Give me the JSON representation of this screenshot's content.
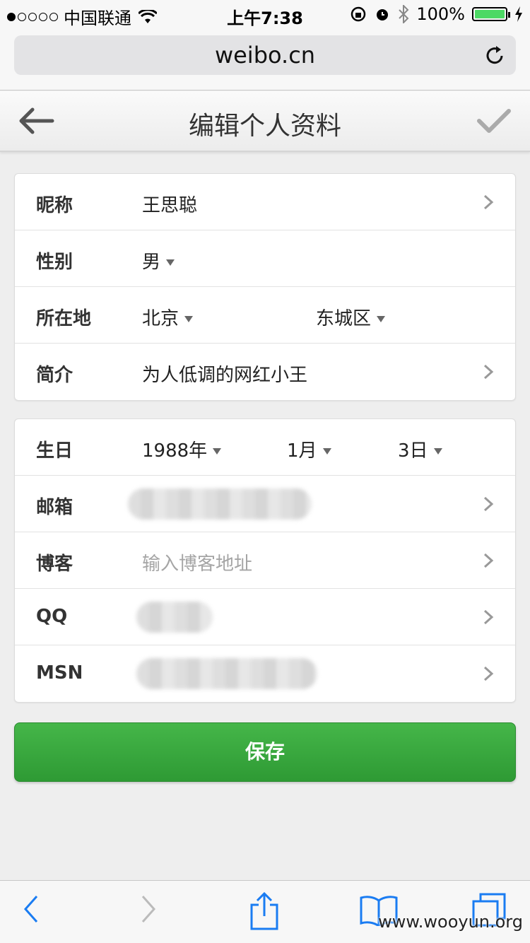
{
  "status_bar": {
    "carrier": "中国联通",
    "time": "上午7:38",
    "battery": "100%"
  },
  "browser": {
    "url": "weibo.cn"
  },
  "header": {
    "title": "编辑个人资料"
  },
  "profile": {
    "nickname_label": "昵称",
    "nickname_value": "王思聪",
    "gender_label": "性别",
    "gender_value": "男",
    "location_label": "所在地",
    "province_value": "北京",
    "district_value": "东城区",
    "bio_label": "简介",
    "bio_value": "为人低调的网红小王"
  },
  "contact": {
    "birthday_label": "生日",
    "year_value": "1988年",
    "month_value": "1月",
    "day_value": "3日",
    "email_label": "邮箱",
    "blog_label": "博客",
    "blog_placeholder": "输入博客地址",
    "qq_label": "QQ",
    "msn_label": "MSN"
  },
  "actions": {
    "save_label": "保存"
  },
  "watermark": "www.wooyun.org",
  "colors": {
    "save_green": "#3aa83f",
    "battery_green": "#4cd964",
    "ios_blue": "#1a7cf2"
  }
}
